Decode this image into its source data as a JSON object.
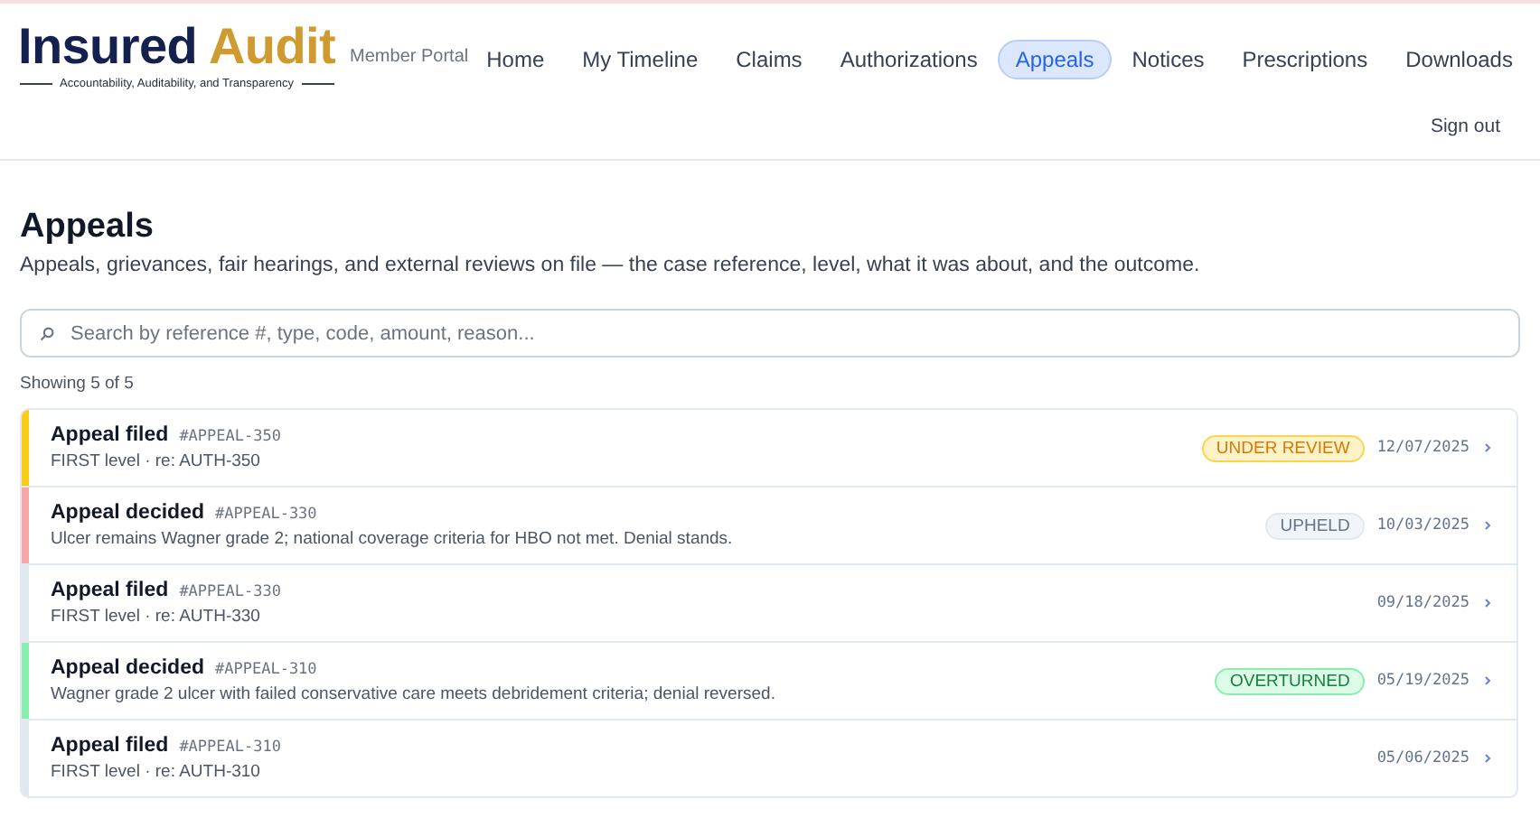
{
  "brand": {
    "name_first": "Insured",
    "name_second": "Audit",
    "tagline": "Accountability, Auditability, and Transparency",
    "portal_label": "Member Portal"
  },
  "nav": [
    {
      "label": "Home",
      "selected": false
    },
    {
      "label": "My Timeline",
      "selected": false
    },
    {
      "label": "Claims",
      "selected": false
    },
    {
      "label": "Authorizations",
      "selected": false
    },
    {
      "label": "Appeals",
      "selected": true
    },
    {
      "label": "Notices",
      "selected": false
    },
    {
      "label": "Prescriptions",
      "selected": false
    },
    {
      "label": "Downloads",
      "selected": false
    }
  ],
  "sign_out": "Sign out",
  "page": {
    "title": "Appeals",
    "description": "Appeals, grievances, fair hearings, and external reviews on file — the case reference, level, what it was about, and the outcome."
  },
  "search": {
    "placeholder": "Search by reference #, type, code, amount, reason..."
  },
  "count": "Showing 5 of 5",
  "rows": [
    {
      "title": "Appeal filed",
      "reference": "#APPEAL-350",
      "detail": "FIRST level · re: AUTH-350",
      "status": {
        "kind": "review",
        "label": "UNDER REVIEW"
      },
      "date": "12/07/2025",
      "color": "#facc15"
    },
    {
      "title": "Appeal decided",
      "reference": "#APPEAL-330",
      "detail": "Ulcer remains Wagner grade 2; national coverage criteria for HBO not met. Denial stands.",
      "status": {
        "kind": "upheld",
        "label": "UPHELD"
      },
      "date": "10/03/2025",
      "color": "#f8a5a5"
    },
    {
      "title": "Appeal filed",
      "reference": "#APPEAL-330",
      "detail": "FIRST level · re: AUTH-330",
      "date": "09/18/2025",
      "color": "#e2e8f0"
    },
    {
      "title": "Appeal decided",
      "reference": "#APPEAL-310",
      "detail": "Wagner grade 2 ulcer with failed conservative care meets debridement criteria; denial reversed.",
      "status": {
        "kind": "overturned",
        "label": "OVERTURNED"
      },
      "date": "05/19/2025",
      "color": "#86efac"
    },
    {
      "title": "Appeal filed",
      "reference": "#APPEAL-310",
      "detail": "FIRST level · re: AUTH-310",
      "date": "05/06/2025",
      "color": "#e2e8f0"
    }
  ]
}
